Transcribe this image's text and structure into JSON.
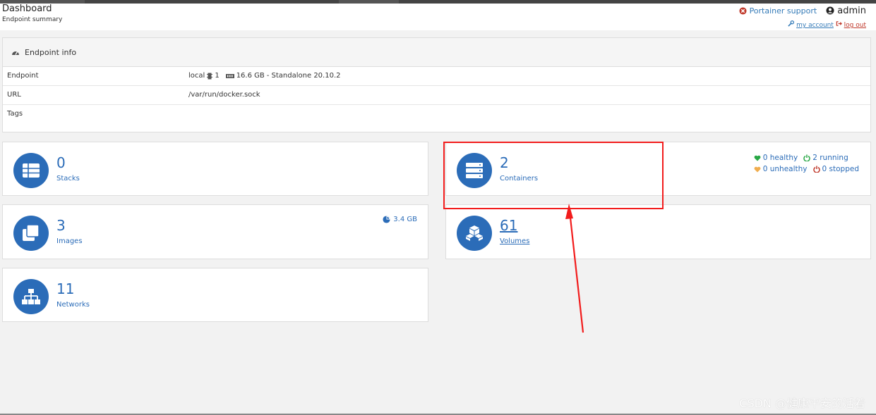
{
  "header": {
    "title": "Dashboard",
    "subtitle": "Endpoint summary",
    "support_label": "Portainer support",
    "user_label": "admin",
    "my_account_label": "my account",
    "logout_label": "log out"
  },
  "endpoint_panel": {
    "title": "Endpoint info",
    "rows": [
      {
        "key": "Endpoint",
        "name": "local",
        "cpu": "1",
        "memory": "16.6 GB",
        "mode": "- Standalone 20.10.2"
      },
      {
        "key": "URL",
        "value": "/var/run/docker.sock"
      },
      {
        "key": "Tags",
        "value": ""
      }
    ]
  },
  "tiles": {
    "stacks": {
      "count": "0",
      "label": "Stacks"
    },
    "containers": {
      "count": "2",
      "label": "Containers",
      "healthy": "0 healthy",
      "running": "2 running",
      "unhealthy": "0 unhealthy",
      "stopped": "0 stopped"
    },
    "images": {
      "count": "3",
      "label": "Images",
      "size": "3.4 GB"
    },
    "volumes": {
      "count": "61",
      "label": "Volumes"
    },
    "networks": {
      "count": "11",
      "label": "Networks"
    }
  },
  "watermark": "CSDN @健康平安的活着",
  "colors": {
    "accent": "#2b6cb8",
    "annotation_red": "#f21c1c",
    "healthy": "#28a745",
    "unhealthy": "#f0ad4e",
    "stopped": "#c0392b"
  },
  "icons": [
    "portainer-support-icon",
    "user-icon",
    "wrench-icon",
    "logout-icon",
    "dashboard-icon",
    "cpu-icon",
    "memory-icon",
    "stacks-icon",
    "containers-icon",
    "images-icon",
    "volumes-icon",
    "networks-icon",
    "pie-chart-icon",
    "heart-icon",
    "power-icon"
  ]
}
